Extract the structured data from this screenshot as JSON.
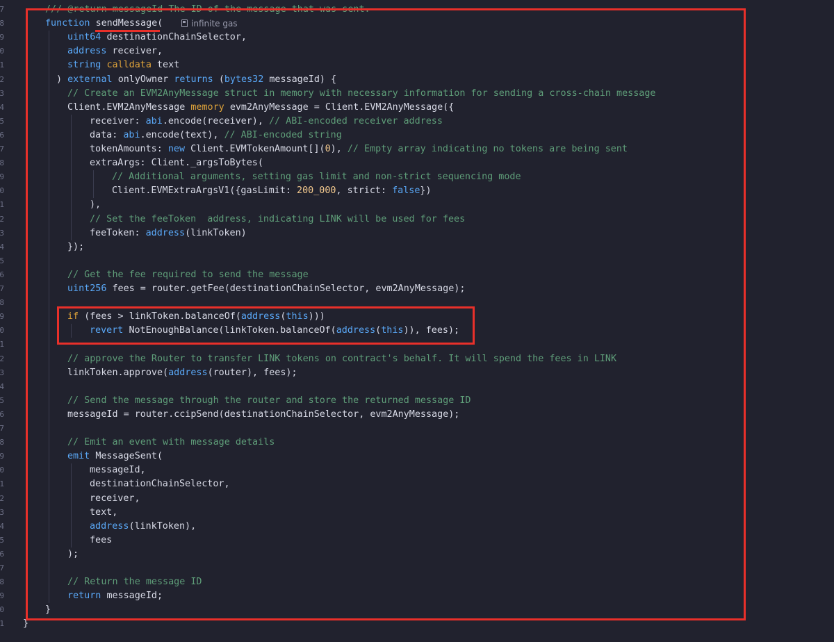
{
  "editor": {
    "gas_hint": "infinite gas",
    "line_numbers": [
      "7",
      "8",
      "9",
      "0",
      "1",
      "2",
      "3",
      "4",
      "5",
      "6",
      "7",
      "8",
      "9",
      "0",
      "1",
      "2",
      "3",
      "4",
      "5",
      "6",
      "7",
      "8",
      "9",
      "0",
      "1",
      "2",
      "3",
      "4",
      "5",
      "6",
      "7",
      "8",
      "9",
      "0",
      "1",
      "2",
      "3",
      "4",
      "5",
      "6",
      "7",
      "8",
      "9",
      "0",
      "1"
    ],
    "lines": [
      [
        {
          "t": "/// @return messageId The ID of the message that was sent.",
          "c": "cm"
        }
      ],
      [
        {
          "t": "function ",
          "c": "kw"
        },
        {
          "t": "sendMessage",
          "c": "fn"
        },
        {
          "t": "(",
          "c": ""
        }
      ],
      [
        {
          "t": "uint64 ",
          "c": "kw"
        },
        {
          "t": "destinationChainSelector,",
          "c": ""
        }
      ],
      [
        {
          "t": "address ",
          "c": "kw"
        },
        {
          "t": "receiver,",
          "c": ""
        }
      ],
      [
        {
          "t": "string ",
          "c": "kw"
        },
        {
          "t": "calldata ",
          "c": "orange"
        },
        {
          "t": "text",
          "c": ""
        }
      ],
      [
        {
          "t": ") ",
          "c": ""
        },
        {
          "t": "external ",
          "c": "kw"
        },
        {
          "t": "onlyOwner ",
          "c": ""
        },
        {
          "t": "returns ",
          "c": "kw"
        },
        {
          "t": "(",
          "c": ""
        },
        {
          "t": "bytes32 ",
          "c": "kw"
        },
        {
          "t": "messageId) {",
          "c": ""
        }
      ],
      [
        {
          "t": "// Create an EVM2AnyMessage struct in memory with necessary information for sending a cross-chain message",
          "c": "cm"
        }
      ],
      [
        {
          "t": "Client.EVM2AnyMessage ",
          "c": ""
        },
        {
          "t": "memory ",
          "c": "orange"
        },
        {
          "t": "evm2AnyMessage = Client.EVM2AnyMessage({",
          "c": ""
        }
      ],
      [
        {
          "t": "receiver: ",
          "c": ""
        },
        {
          "t": "abi",
          "c": "kw"
        },
        {
          "t": ".encode(receiver), ",
          "c": ""
        },
        {
          "t": "// ABI-encoded receiver address",
          "c": "cm"
        }
      ],
      [
        {
          "t": "data: ",
          "c": ""
        },
        {
          "t": "abi",
          "c": "kw"
        },
        {
          "t": ".encode(text), ",
          "c": ""
        },
        {
          "t": "// ABI-encoded string",
          "c": "cm"
        }
      ],
      [
        {
          "t": "tokenAmounts: ",
          "c": ""
        },
        {
          "t": "new ",
          "c": "kw"
        },
        {
          "t": "Client.EVMTokenAmount[](",
          "c": ""
        },
        {
          "t": "0",
          "c": "num"
        },
        {
          "t": "), ",
          "c": ""
        },
        {
          "t": "// Empty array indicating no tokens are being sent",
          "c": "cm"
        }
      ],
      [
        {
          "t": "extraArgs: Client._argsToBytes(",
          "c": ""
        }
      ],
      [
        {
          "t": "// Additional arguments, setting gas limit and non-strict sequencing mode",
          "c": "cm"
        }
      ],
      [
        {
          "t": "Client.EVMExtraArgsV1({gasLimit: ",
          "c": ""
        },
        {
          "t": "200_000",
          "c": "num"
        },
        {
          "t": ", strict: ",
          "c": ""
        },
        {
          "t": "false",
          "c": "kw"
        },
        {
          "t": "})",
          "c": ""
        }
      ],
      [
        {
          "t": "),",
          "c": ""
        }
      ],
      [
        {
          "t": "// Set the feeToken  address, indicating LINK will be used for fees",
          "c": "cm"
        }
      ],
      [
        {
          "t": "feeToken: ",
          "c": ""
        },
        {
          "t": "address",
          "c": "kw"
        },
        {
          "t": "(linkToken)",
          "c": ""
        }
      ],
      [
        {
          "t": "});",
          "c": ""
        }
      ],
      [],
      [
        {
          "t": "// Get the fee required to send the message",
          "c": "cm"
        }
      ],
      [
        {
          "t": "uint256 ",
          "c": "kw"
        },
        {
          "t": "fees = router.getFee(destinationChainSelector, evm2AnyMessage);",
          "c": ""
        }
      ],
      [],
      [
        {
          "t": "if ",
          "c": "orange"
        },
        {
          "t": "(fees > linkToken.balanceOf(",
          "c": ""
        },
        {
          "t": "address",
          "c": "kw"
        },
        {
          "t": "(",
          "c": ""
        },
        {
          "t": "this",
          "c": "kw"
        },
        {
          "t": ")))",
          "c": ""
        }
      ],
      [
        {
          "t": "revert ",
          "c": "kw"
        },
        {
          "t": "NotEnoughBalance(linkToken.balanceOf(",
          "c": ""
        },
        {
          "t": "address",
          "c": "kw"
        },
        {
          "t": "(",
          "c": ""
        },
        {
          "t": "this",
          "c": "kw"
        },
        {
          "t": ")), fees);",
          "c": ""
        }
      ],
      [],
      [
        {
          "t": "// approve the Router to transfer LINK tokens on contract's behalf. It will spend the fees in LINK",
          "c": "cm"
        }
      ],
      [
        {
          "t": "linkToken.approve(",
          "c": ""
        },
        {
          "t": "address",
          "c": "kw"
        },
        {
          "t": "(router), fees);",
          "c": ""
        }
      ],
      [],
      [
        {
          "t": "// Send the message through the router and store the returned message ID",
          "c": "cm"
        }
      ],
      [
        {
          "t": "messageId = router.ccipSend(destinationChainSelector, evm2AnyMessage);",
          "c": ""
        }
      ],
      [],
      [
        {
          "t": "// Emit an event with message details",
          "c": "cm"
        }
      ],
      [
        {
          "t": "emit ",
          "c": "kw"
        },
        {
          "t": "MessageSent(",
          "c": ""
        }
      ],
      [
        {
          "t": "messageId,",
          "c": ""
        }
      ],
      [
        {
          "t": "destinationChainSelector,",
          "c": ""
        }
      ],
      [
        {
          "t": "receiver,",
          "c": ""
        }
      ],
      [
        {
          "t": "text,",
          "c": ""
        }
      ],
      [
        {
          "t": "address",
          "c": "kw"
        },
        {
          "t": "(linkToken),",
          "c": ""
        }
      ],
      [
        {
          "t": "fees",
          "c": ""
        }
      ],
      [
        {
          "t": ");",
          "c": ""
        }
      ],
      [],
      [
        {
          "t": "// Return the message ID",
          "c": "cm"
        }
      ],
      [
        {
          "t": "return ",
          "c": "kw"
        },
        {
          "t": "messageId;",
          "c": ""
        }
      ],
      [
        {
          "t": "}",
          "c": ""
        }
      ],
      [
        {
          "t": "}",
          "c": ""
        }
      ]
    ]
  },
  "colors": {
    "background": "#21222e",
    "keyword": "#5aa8f7",
    "storage_keyword": "#e0a43a",
    "comment": "#5f9e79",
    "number": "#f3c98e",
    "annotation": "#e8302a"
  }
}
